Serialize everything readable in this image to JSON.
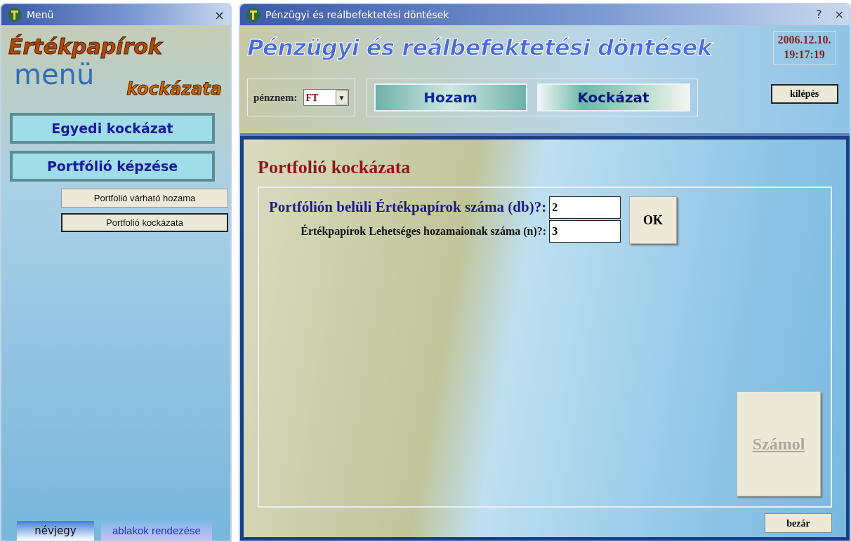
{
  "menu_window": {
    "title": "Menü",
    "close": "×",
    "logo": {
      "line_1": "Értékpapírok",
      "watermark": "menü",
      "line_2": "kockázata"
    },
    "items": [
      {
        "label": "Egyedi kockázat",
        "kind": "main",
        "selected": false
      },
      {
        "label": "Portfólió képzése",
        "kind": "main",
        "selected": false
      },
      {
        "label": "Portfolió várható hozama",
        "kind": "sub",
        "selected": false
      },
      {
        "label": "Portfolió kockázata",
        "kind": "sub",
        "selected": true
      }
    ],
    "footer_buttons": [
      {
        "label": "névjegy",
        "kind": "light"
      },
      {
        "label": "ablakok rendezése",
        "kind": "blue"
      }
    ]
  },
  "main_window": {
    "title": "Pénzügyi és reálbefektetési döntések",
    "help": "?",
    "close": "×",
    "header": {
      "heading": "Pénzügyi és reálbefektetési döntések",
      "date": "2006.12.10.",
      "time": "19:17:19",
      "currency": {
        "label": "pénznem:",
        "value": "FT",
        "arrow": "▼"
      },
      "tabs": [
        {
          "label": "Hozam",
          "selected": false
        },
        {
          "label": "Kockázat",
          "selected": true
        }
      ],
      "exit_button": "kilépés"
    },
    "panel": {
      "heading": "Portfolió kockázata",
      "fields": [
        {
          "label": "Portfólión belüli Értékpapírok száma (db)?:",
          "value": "2",
          "kind": "primary"
        },
        {
          "label": "Értékpapírok Lehetséges hozamaionak száma (n)?:",
          "value": "3",
          "kind": "secondary"
        }
      ],
      "ok_button": {
        "label": "OK",
        "disabled": false
      },
      "calc_button": {
        "label": "Számol",
        "disabled": true
      },
      "close_button": "bezár"
    }
  }
}
